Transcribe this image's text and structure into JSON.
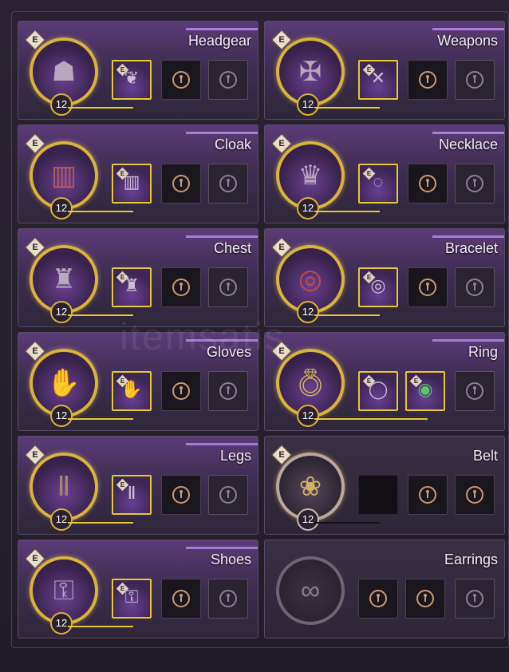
{
  "slots": [
    {
      "title": "Headgear",
      "level": "12",
      "grade": "E",
      "icon": "hood-icon",
      "equip_icon": "feather-icon",
      "state": "active"
    },
    {
      "title": "Weapons",
      "level": "12",
      "grade": "E",
      "icon": "crossbow-icon",
      "equip_icon": "crossbow-icon",
      "state": "active"
    },
    {
      "title": "Cloak",
      "level": "12",
      "grade": "E",
      "icon": "cloak-icon",
      "equip_icon": "cloak-icon",
      "state": "active"
    },
    {
      "title": "Necklace",
      "level": "12",
      "grade": "E",
      "icon": "necklace-icon",
      "equip_icon": "necklace-icon",
      "state": "active"
    },
    {
      "title": "Chest",
      "level": "12",
      "grade": "E",
      "icon": "chest-armor-icon",
      "equip_icon": "chest-armor-icon",
      "state": "active"
    },
    {
      "title": "Bracelet",
      "level": "12",
      "grade": "E",
      "icon": "bracelet-icon",
      "equip_icon": "bracelet-icon",
      "state": "active"
    },
    {
      "title": "Gloves",
      "level": "12",
      "grade": "E",
      "icon": "gauntlet-icon",
      "equip_icon": "glove-icon",
      "state": "active"
    },
    {
      "title": "Ring",
      "level": "12",
      "grade": "E",
      "icon": "ring-icon",
      "equip_icon": "ring-icon",
      "state": "active"
    },
    {
      "title": "Legs",
      "level": "12",
      "grade": "E",
      "icon": "pants-icon",
      "equip_icon": "pants-icon",
      "state": "active"
    },
    {
      "title": "Belt",
      "level": "12",
      "grade": "E",
      "icon": "belt-icon",
      "equip_icon": "",
      "state": "dim"
    },
    {
      "title": "Shoes",
      "level": "12",
      "grade": "E",
      "icon": "boots-icon",
      "equip_icon": "boots-icon",
      "state": "active"
    },
    {
      "title": "Earrings",
      "level": "",
      "grade": "",
      "icon": "earrings-icon",
      "equip_icon": "",
      "state": "empty"
    }
  ],
  "ring_extra": {
    "grade": "E",
    "icon": "gem-ring-icon"
  },
  "watermark": "itemsatis"
}
